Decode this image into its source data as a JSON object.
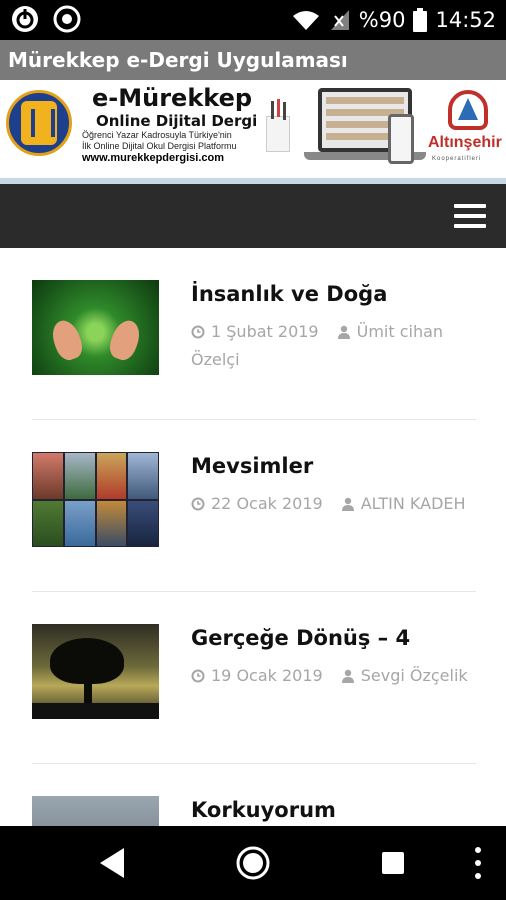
{
  "status_bar": {
    "battery_percent": "%90",
    "time": "14:52",
    "icons": [
      "power-icon",
      "sync-icon",
      "wifi-icon",
      "signal-icon",
      "battery-icon"
    ]
  },
  "app": {
    "title": "Mürekkep e-Dergi Uygulaması"
  },
  "banner": {
    "title": "e-Mürekkep",
    "subtitle": "Online Dijital Dergi",
    "line1": "Öğrenci Yazar Kadrosuyla Türkiye'nin",
    "line2": "İlk Online Dijital Okul Dergisi Platformu",
    "url": "www.murekkepdergisi.com",
    "partner_name": "Altınşehir",
    "partner_sub": "Kooperatifleri"
  },
  "posts": [
    {
      "title": "İnsanlık ve Doğa",
      "date": "1 Şubat 2019",
      "author": "Ümit cihan Özelçi"
    },
    {
      "title": "Mevsimler",
      "date": "22 Ocak 2019",
      "author": "ALTIN KADEH"
    },
    {
      "title": "Gerçeğe Dönüş – 4",
      "date": "19 Ocak 2019",
      "author": "Sevgi Özçelik"
    },
    {
      "title": "Korkuyorum",
      "date": "",
      "author": ""
    }
  ],
  "colors": {
    "app_bar": "#7a7a7a",
    "navbar": "#2b2b2b",
    "meta_text": "#a6a6a6",
    "title_text": "#111111"
  }
}
